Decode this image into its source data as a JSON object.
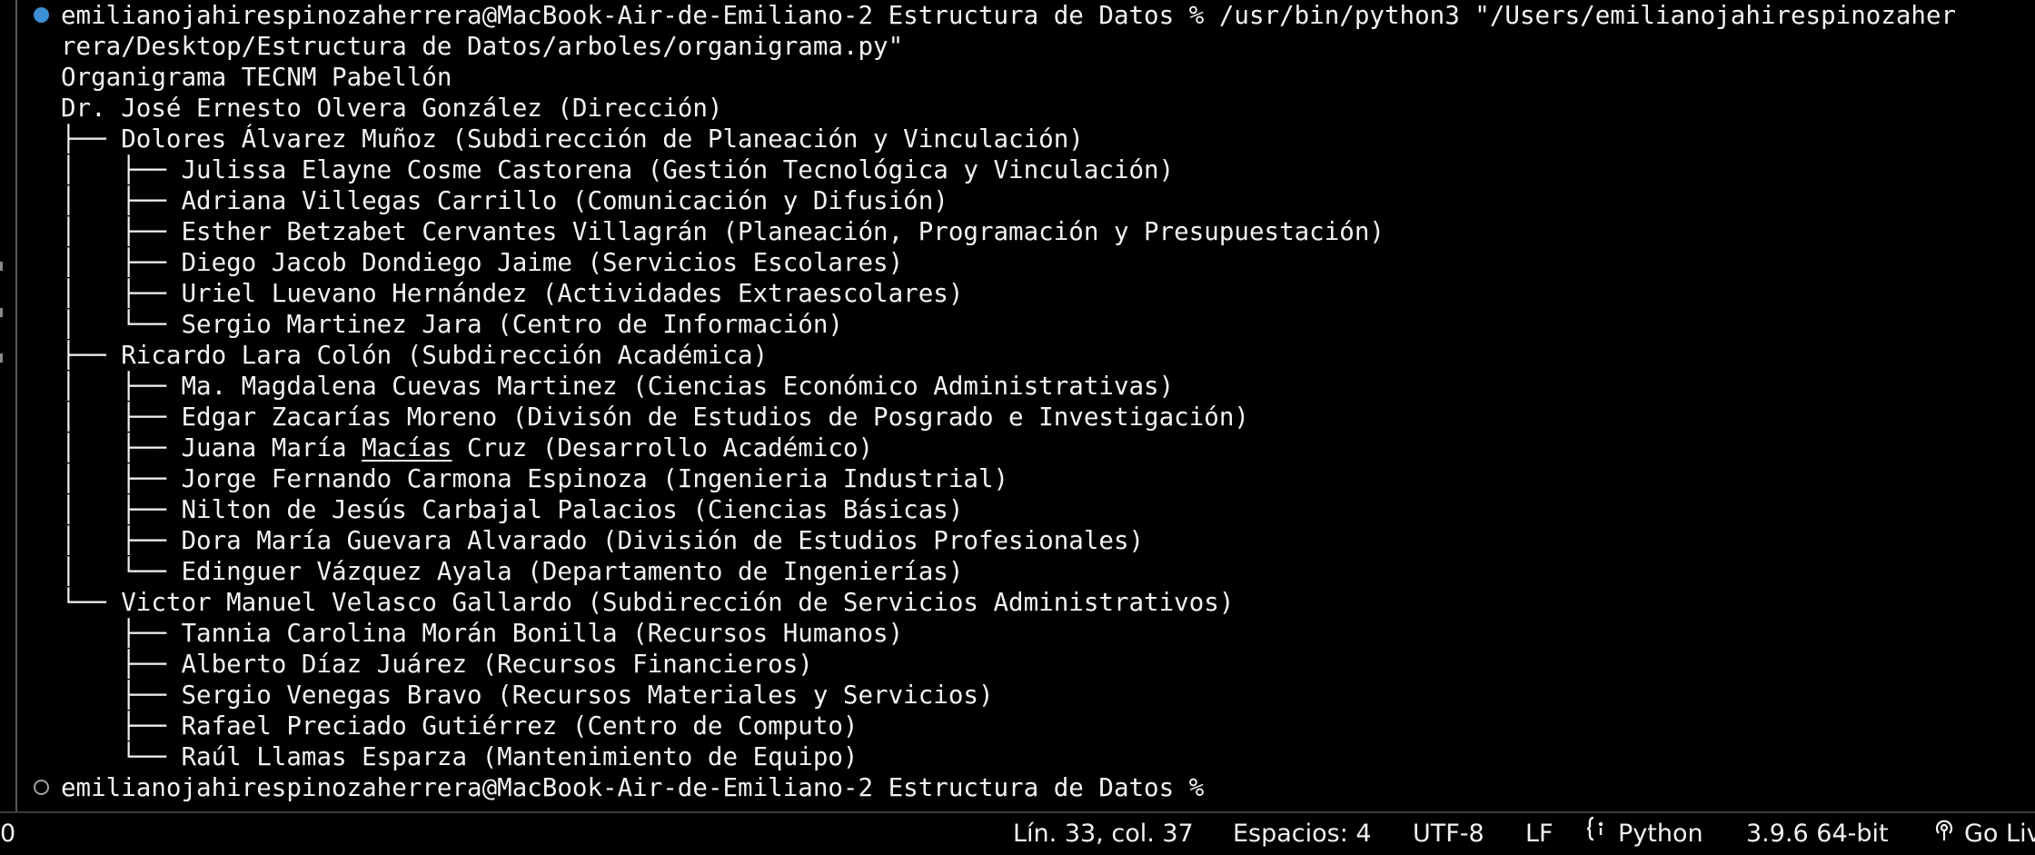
{
  "terminal": {
    "command_prompt": "emilianojahirespinozaherrera@MacBook-Air-de-Emiliano-2 Estructura de Datos % /usr/bin/python3 \"/Users/emilianojahirespinozaher",
    "command_wrap": "rera/Desktop/Estructura de Datos/arboles/organigrama.py\"",
    "title": "Organigrama TECNM Pabellón",
    "root": "Dr. José Ernesto Olvera González (Dirección)",
    "branches": [
      {
        "head": "├── Dolores Álvarez Muñoz (Subdirección de Planeación y Vinculación)",
        "children": [
          "│   ├── Julissa Elayne Cosme Castorena (Gestión Tecnológica y Vinculación)",
          "│   ├── Adriana Villegas Carrillo (Comunicación y Difusión)",
          "│   ├── Esther Betzabet Cervantes Villagrán (Planeación, Programación y Presupuestación)",
          "│   ├── Diego Jacob Dondiego Jaime (Servicios Escolares)",
          "│   ├── Uriel Luevano Hernández (Actividades Extraescolares)",
          "│   └── Sergio Martinez Jara (Centro de Información)"
        ]
      },
      {
        "head": "├── Ricardo Lara Colón (Subdirección Académica)",
        "children": [
          "│   ├── Ma. Magdalena Cuevas Martinez (Ciencias Económico Administrativas)",
          "│   ├── Edgar Zacarías Moreno (Divisón de Estudios de Posgrado e Investigación)",
          "│   ├── Juana María Macías Cruz (Desarrollo Académico)",
          "│   ├── Jorge Fernando Carmona Espinoza (Ingenieria Industrial)",
          "│   ├── Nilton de Jesús Carbajal Palacios (Ciencias Básicas)",
          "│   ├── Dora María Guevara Alvarado (División de Estudios Profesionales)",
          "│   └── Edinguer Vázquez Ayala (Departamento de Ingenierías)"
        ]
      },
      {
        "head": "└── Victor Manuel Velasco Gallardo (Subdirección de Servicios Administrativos)",
        "children": [
          "    ├── Tannia Carolina Morán Bonilla (Recursos Humanos)",
          "    ├── Alberto Díaz Juárez (Recursos Financieros)",
          "    ├── Sergio Venegas Bravo (Recursos Materiales y Servicios)",
          "    ├── Rafael Preciado Gutiérrez (Centro de Computo)",
          "    └── Raúl Llamas Esparza (Mantenimiento de Equipo)"
        ]
      }
    ],
    "underlined_line": {
      "before": "│   ├── Juana María ",
      "word": "Macías",
      "after": " Cruz (Desarrollo Académico)"
    },
    "final_prompt": "emilianojahirespinozaherrera@MacBook-Air-de-Emiliano-2 Estructura de Datos %"
  },
  "statusbar": {
    "left_text": "0",
    "position": "Lín. 33, col. 37",
    "indent": "Espacios: 4",
    "encoding": "UTF-8",
    "eol": "LF",
    "language_icon": "braces-icon",
    "language": "Python",
    "interpreter": "3.9.6 64-bit",
    "golive_icon": "broadcast-icon",
    "golive": "Go Live"
  },
  "colors": {
    "background": "#000000",
    "text": "#f2f2f2",
    "success_dot": "#3d8fd6",
    "pending_dot": "#a0a0a0"
  }
}
